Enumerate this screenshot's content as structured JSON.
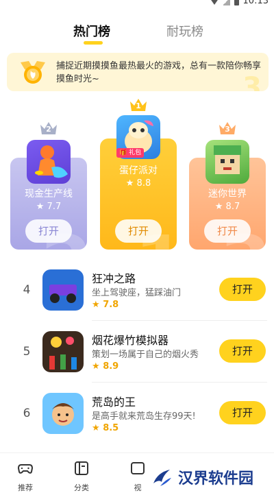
{
  "status": {
    "time": "10:13"
  },
  "tabs": {
    "active": "热门榜",
    "inactive": "耐玩榜"
  },
  "banner": {
    "text": "捕捉近期摸摸鱼最热最火的游戏，总有一款陪你畅享摸鱼时光~"
  },
  "podium": [
    {
      "rank": "1",
      "name": "蛋仔派对",
      "rating": "8.8",
      "tag": "礼包",
      "button": "打开"
    },
    {
      "rank": "2",
      "name": "现金生产线",
      "rating": "7.7",
      "button": "打开"
    },
    {
      "rank": "3",
      "name": "迷你世界",
      "rating": "8.7",
      "button": "打开"
    }
  ],
  "list": [
    {
      "rank": "4",
      "title": "狂冲之路",
      "desc": "坐上驾驶座，猛踩油门",
      "rating": "7.8",
      "button": "打开"
    },
    {
      "rank": "5",
      "title": "烟花爆竹模拟器",
      "desc": "策划一场属于自己的烟火秀",
      "rating": "8.9",
      "button": "打开"
    },
    {
      "rank": "6",
      "title": "荒岛的王",
      "desc": "是高手就来荒岛生存99天!",
      "rating": "8.5",
      "button": "打开"
    }
  ],
  "nav": {
    "recommend": "推荐",
    "category": "分类",
    "video": "视"
  },
  "watermark": "汉界软件园",
  "colors": {
    "accent": "#ffd21e",
    "star": "#f0a500"
  }
}
